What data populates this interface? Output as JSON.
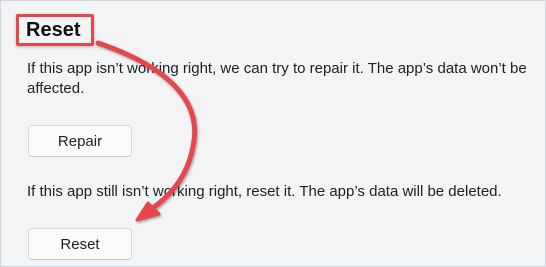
{
  "section": {
    "title": "Reset",
    "repair_description": "If this app isn’t working right, we can try to repair it. The app’s data won’t be affected.",
    "repair_button_label": "Repair",
    "reset_description": "If this app still isn’t working right, reset it. The app’s data will be deleted.",
    "reset_button_label": "Reset"
  },
  "annotation": {
    "highlight_color": "#e5474d",
    "arrow_color": "#e5474d"
  }
}
